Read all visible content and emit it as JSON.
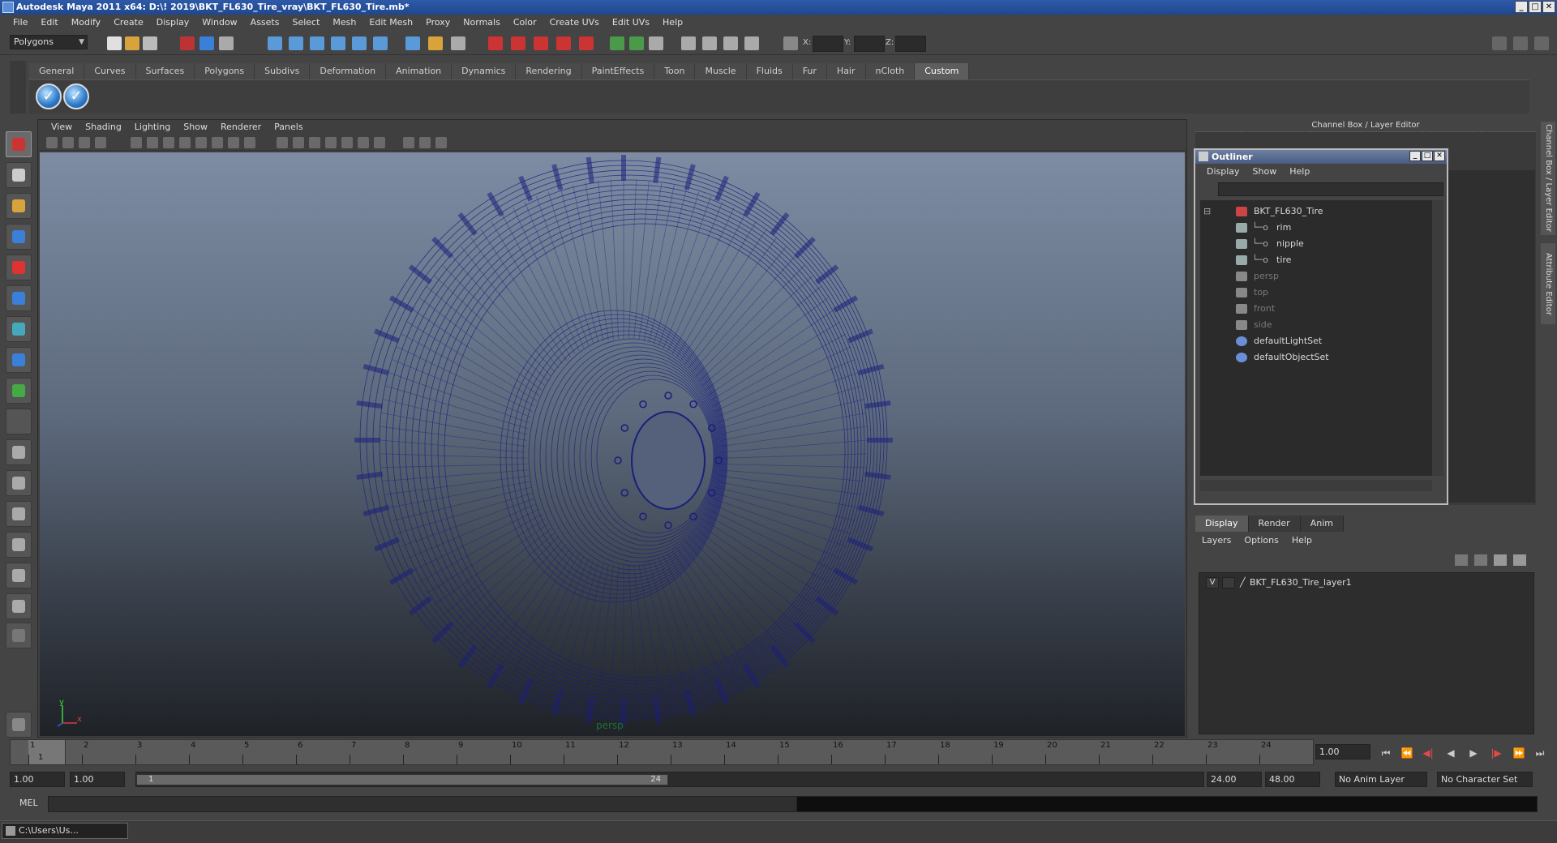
{
  "window": {
    "title": "Autodesk Maya 2011 x64: D:\\! 2019\\BKT_FL630_Tire_vray\\BKT_FL630_Tire.mb*",
    "min": "_",
    "max": "□",
    "close": "✕"
  },
  "menubar": [
    "File",
    "Edit",
    "Modify",
    "Create",
    "Display",
    "Window",
    "Assets",
    "Select",
    "Mesh",
    "Edit Mesh",
    "Proxy",
    "Normals",
    "Color",
    "Create UVs",
    "Edit UVs",
    "Help"
  ],
  "statusline": {
    "mode": "Polygons",
    "x_label": "X:",
    "y_label": "Y:",
    "z_label": "Z:"
  },
  "shelf": {
    "tabs": [
      "General",
      "Curves",
      "Surfaces",
      "Polygons",
      "Subdivs",
      "Deformation",
      "Animation",
      "Dynamics",
      "Rendering",
      "PaintEffects",
      "Toon",
      "Muscle",
      "Fluids",
      "Fur",
      "Hair",
      "nCloth",
      "Custom"
    ],
    "active_tab": "Custom",
    "buttons": [
      "✓",
      "✓"
    ]
  },
  "viewport": {
    "menu": [
      "View",
      "Shading",
      "Lighting",
      "Show",
      "Renderer",
      "Panels"
    ],
    "camera": "persp",
    "axis_x": "x",
    "axis_y": "y",
    "wire_color": "#1a1f7a"
  },
  "channel_box": {
    "title": "Channel Box / Layer Editor"
  },
  "side_tabs": [
    "Channel Box / Layer Editor",
    "Attribute Editor"
  ],
  "outliner": {
    "title": "Outliner",
    "menu": [
      "Display",
      "Show",
      "Help"
    ],
    "items": [
      {
        "label": "BKT_FL630_Tire",
        "indent": 0,
        "dim": false,
        "icon": "transform-icon",
        "expand": "⊟"
      },
      {
        "label": "rim",
        "indent": 1,
        "dim": false,
        "icon": "mesh-icon"
      },
      {
        "label": "nipple",
        "indent": 1,
        "dim": false,
        "icon": "mesh-icon"
      },
      {
        "label": "tire",
        "indent": 1,
        "dim": false,
        "icon": "mesh-icon"
      },
      {
        "label": "persp",
        "indent": 0,
        "dim": true,
        "icon": "camera-icon"
      },
      {
        "label": "top",
        "indent": 0,
        "dim": true,
        "icon": "camera-icon"
      },
      {
        "label": "front",
        "indent": 0,
        "dim": true,
        "icon": "camera-icon"
      },
      {
        "label": "side",
        "indent": 0,
        "dim": true,
        "icon": "camera-icon"
      },
      {
        "label": "defaultLightSet",
        "indent": 0,
        "dim": false,
        "icon": "set-icon"
      },
      {
        "label": "defaultObjectSet",
        "indent": 0,
        "dim": false,
        "icon": "set-icon"
      }
    ]
  },
  "layer_editor": {
    "tabs": [
      "Display",
      "Render",
      "Anim"
    ],
    "active_tab": "Display",
    "menu": [
      "Layers",
      "Options",
      "Help"
    ],
    "layer": {
      "visible": "V",
      "name": "BKT_FL630_Tire_layer1"
    }
  },
  "timeline": {
    "ticks": [
      "1",
      "2",
      "3",
      "4",
      "5",
      "6",
      "7",
      "8",
      "9",
      "10",
      "11",
      "12",
      "13",
      "14",
      "15",
      "16",
      "17",
      "18",
      "19",
      "20",
      "21",
      "22",
      "23",
      "24"
    ],
    "current_frame_marker": "1",
    "current_frame": "1.00"
  },
  "range": {
    "start": "1.00",
    "playback_start": "1.00",
    "bar_start": "1",
    "bar_end": "24",
    "playback_end": "24.00",
    "end": "48.00",
    "anim_layer": "No Anim Layer",
    "character_set": "No Character Set"
  },
  "command": {
    "label": "MEL"
  },
  "taskbar": {
    "item": "C:\\Users\\Us..."
  }
}
